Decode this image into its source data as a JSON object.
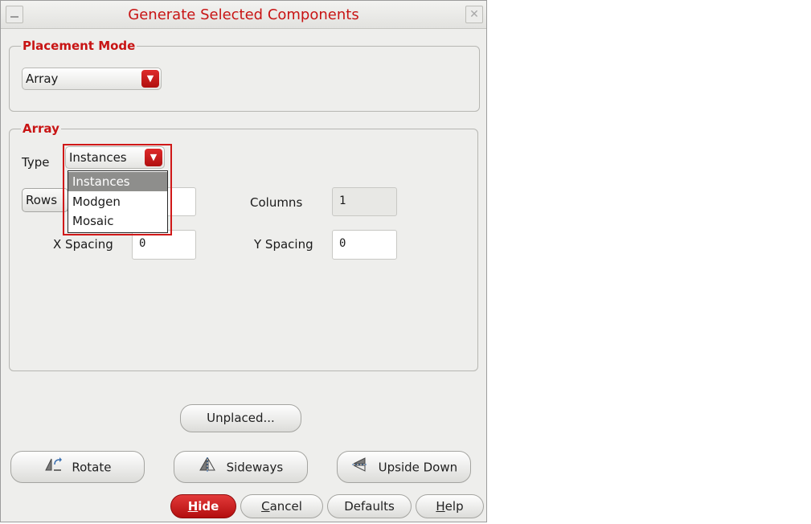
{
  "window": {
    "title": "Generate Selected Components"
  },
  "placement_mode": {
    "legend": "Placement Mode",
    "select_value": "Array"
  },
  "array": {
    "legend": "Array",
    "type_label": "Type",
    "type_value": "Instances",
    "type_options": [
      "Instances",
      "Modgen",
      "Mosaic"
    ],
    "type_selected": "Instances",
    "rows_label": "Rows",
    "columns_label": "Columns",
    "columns_value": "1",
    "x_spacing_label": "X Spacing",
    "x_spacing_value": "0",
    "y_spacing_label": "Y Spacing",
    "y_spacing_value": "0"
  },
  "buttons": {
    "unplaced": "Unplaced...",
    "rotate": "Rotate",
    "sideways": "Sideways",
    "upside_down": "Upside Down",
    "hide_mnemonic": "H",
    "hide_rest": "ide",
    "cancel_mnemonic": "C",
    "cancel_rest": "ancel",
    "defaults": "Defaults",
    "help_mnemonic": "H",
    "help_rest": "elp"
  },
  "colors": {
    "accent_red": "#c81414",
    "window_bg": "#eeeeec",
    "selection_gray": "#8e8e8c"
  },
  "icons": {
    "rotate": "rotate-icon",
    "sideways": "sideways-icon",
    "upside_down": "upside-down-icon"
  }
}
